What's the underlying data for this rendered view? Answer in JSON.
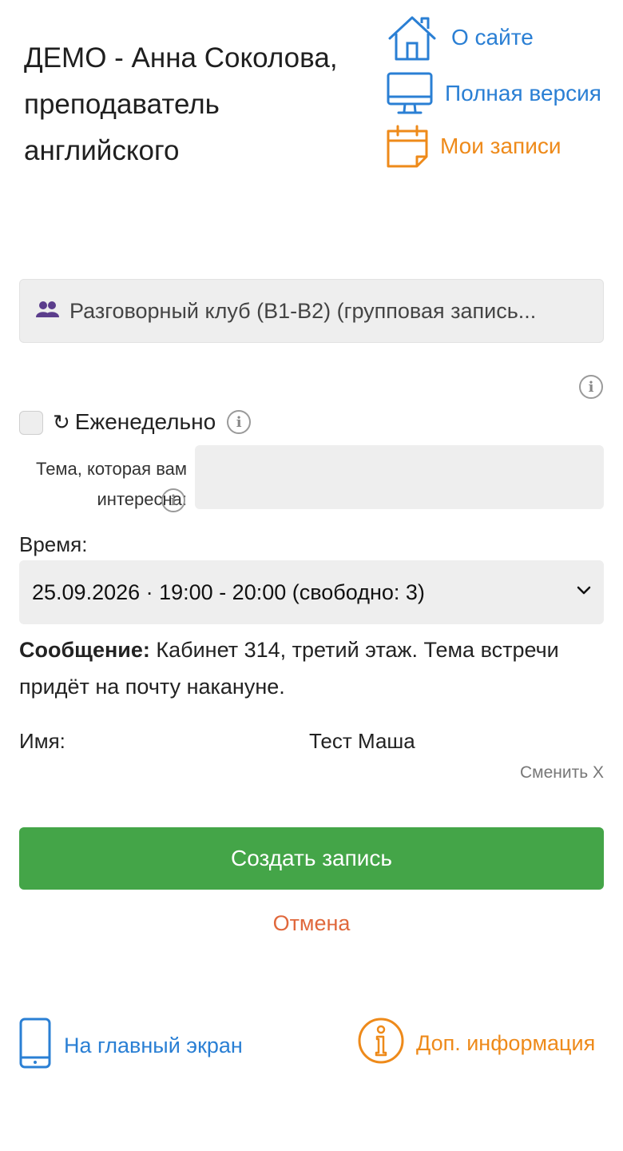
{
  "header": {
    "title": "ДЕМО - Анна Соколова, преподаватель английского",
    "nav": {
      "about": "О сайте",
      "full_version": "Полная версия",
      "my_bookings": "Мои записи"
    }
  },
  "service": {
    "selected": "Разговорный клуб (B1-B2) (групповая запись..."
  },
  "repeat": {
    "label": "Еженедельно",
    "checked": false
  },
  "topic": {
    "label": "Тема, которая вам интересна:",
    "value": ""
  },
  "time": {
    "label": "Время:",
    "selected": "25.09.2026 · 19:00 - 20:00 (свободно: 3)"
  },
  "message": {
    "label": "Сообщение:",
    "text": "Кабинет 314, третий этаж. Тема встречи придёт на почту накануне."
  },
  "name": {
    "label": "Имя:",
    "value": "Тест Маша",
    "change": "Сменить X"
  },
  "actions": {
    "submit": "Создать запись",
    "cancel": "Отмена"
  },
  "footer": {
    "home_screen": "На главный экран",
    "more_info": "Доп. информация"
  },
  "colors": {
    "link_blue": "#2a7fd4",
    "accent_orange": "#ee8a1a",
    "submit_green": "#44a548",
    "cancel_red": "#e0683c",
    "group_icon_purple": "#5b3d8c"
  },
  "icons": {
    "about": "house-icon",
    "full_version": "monitor-icon",
    "my_bookings": "calendar-icon",
    "service": "group-icon",
    "repeat": "repeat-icon",
    "info": "info-icon",
    "dropdown": "chevron-down-icon",
    "home_screen": "phone-icon",
    "more_info": "info-circle-icon"
  }
}
